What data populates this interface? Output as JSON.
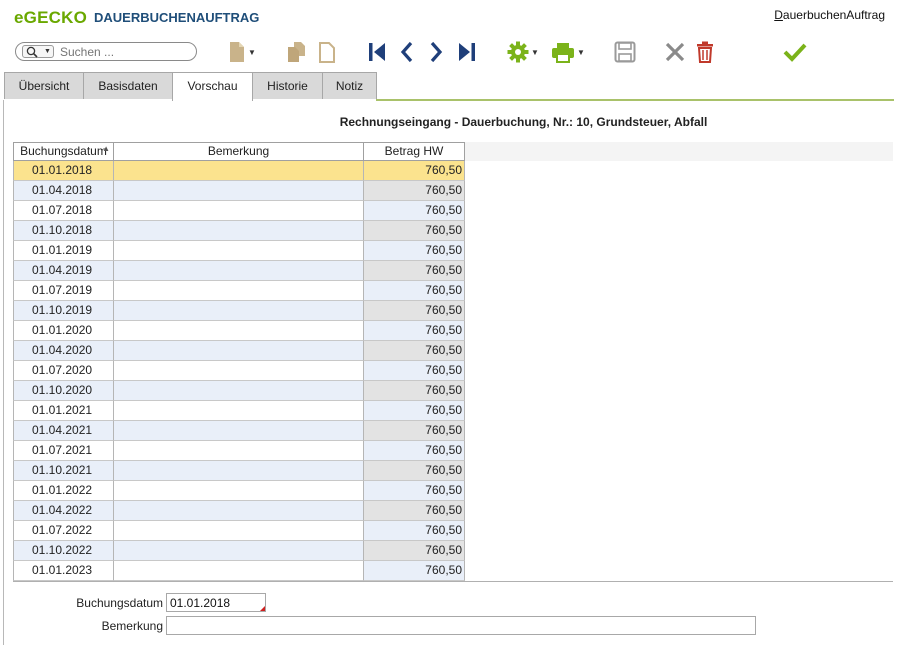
{
  "header": {
    "logo": "eGECKO",
    "app_title": "DAUERBUCHENAUFTRAG",
    "right_title_first": "D",
    "right_title_rest": "auerbuchenAuftrag"
  },
  "search": {
    "placeholder": "Suchen ..."
  },
  "toolbar": {
    "icons": [
      "document-icon",
      "copy-icon",
      "paste-icon",
      "first-record-icon",
      "previous-record-icon",
      "next-record-icon",
      "last-record-icon",
      "settings-gear-icon",
      "print-icon",
      "save-icon",
      "close-x-icon",
      "delete-trash-icon",
      "confirm-check-icon"
    ],
    "colors": {
      "green": "#7bb31a",
      "navy": "#1f3f7a",
      "grey": "#8a8a8a",
      "red": "#c0392b",
      "beige": "#c9b38a"
    }
  },
  "tabs": [
    {
      "label": "Übersicht",
      "active": false
    },
    {
      "label": "Basisdaten",
      "active": false
    },
    {
      "label": "Vorschau",
      "active": true
    },
    {
      "label": "Historie",
      "active": false
    },
    {
      "label": "Notiz",
      "active": false
    }
  ],
  "caption": "Rechnungseingang - Dauerbuchung,  Nr.: 10,  Grundsteuer, Abfall",
  "grid": {
    "columns": [
      "Buchungsdatum",
      "Bemerkung",
      "Betrag HW"
    ],
    "selected_row": 0,
    "rows": [
      {
        "date": "01.01.2018",
        "remark": "",
        "amount": "760,50"
      },
      {
        "date": "01.04.2018",
        "remark": "",
        "amount": "760,50"
      },
      {
        "date": "01.07.2018",
        "remark": "",
        "amount": "760,50"
      },
      {
        "date": "01.10.2018",
        "remark": "",
        "amount": "760,50"
      },
      {
        "date": "01.01.2019",
        "remark": "",
        "amount": "760,50"
      },
      {
        "date": "01.04.2019",
        "remark": "",
        "amount": "760,50"
      },
      {
        "date": "01.07.2019",
        "remark": "",
        "amount": "760,50"
      },
      {
        "date": "01.10.2019",
        "remark": "",
        "amount": "760,50"
      },
      {
        "date": "01.01.2020",
        "remark": "",
        "amount": "760,50"
      },
      {
        "date": "01.04.2020",
        "remark": "",
        "amount": "760,50"
      },
      {
        "date": "01.07.2020",
        "remark": "",
        "amount": "760,50"
      },
      {
        "date": "01.10.2020",
        "remark": "",
        "amount": "760,50"
      },
      {
        "date": "01.01.2021",
        "remark": "",
        "amount": "760,50"
      },
      {
        "date": "01.04.2021",
        "remark": "",
        "amount": "760,50"
      },
      {
        "date": "01.07.2021",
        "remark": "",
        "amount": "760,50"
      },
      {
        "date": "01.10.2021",
        "remark": "",
        "amount": "760,50"
      },
      {
        "date": "01.01.2022",
        "remark": "",
        "amount": "760,50"
      },
      {
        "date": "01.04.2022",
        "remark": "",
        "amount": "760,50"
      },
      {
        "date": "01.07.2022",
        "remark": "",
        "amount": "760,50"
      },
      {
        "date": "01.10.2022",
        "remark": "",
        "amount": "760,50"
      },
      {
        "date": "01.01.2023",
        "remark": "",
        "amount": "760,50"
      }
    ]
  },
  "form": {
    "date_label": "Buchungsdatum",
    "date_value": "01.01.2018",
    "remark_label": "Bemerkung",
    "remark_value": ""
  }
}
